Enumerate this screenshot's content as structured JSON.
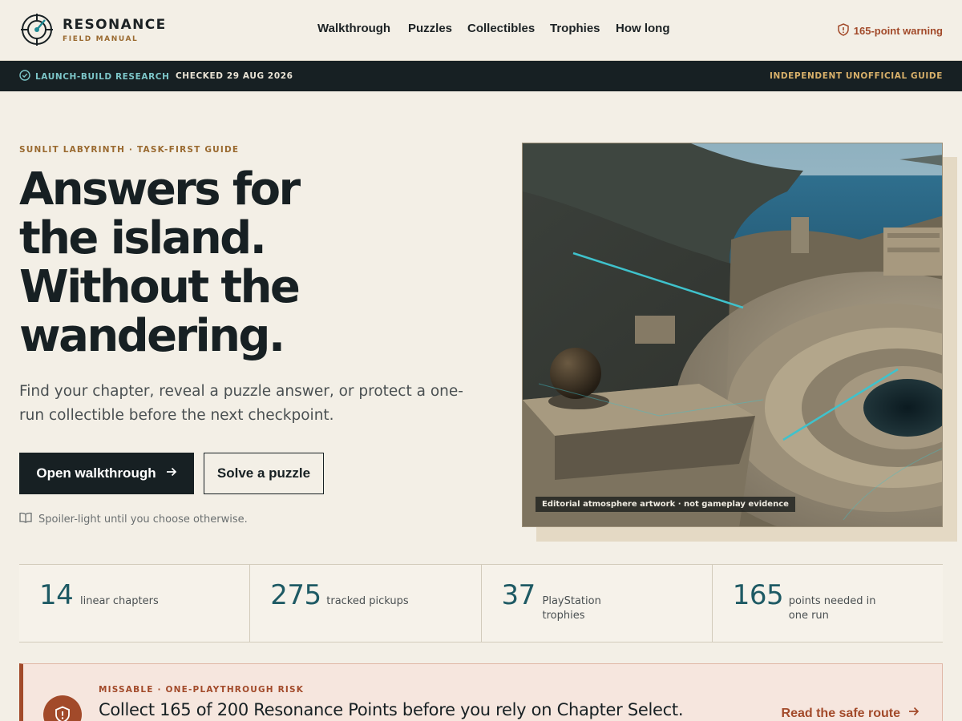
{
  "brand": {
    "name": "RESONANCE",
    "subtitle": "FIELD MANUAL",
    "logo_icon": "compass-target-icon"
  },
  "nav": {
    "items": [
      {
        "label": "Walkthrough"
      },
      {
        "label": "Puzzles"
      },
      {
        "label": "Collectibles"
      },
      {
        "label": "Trophies"
      },
      {
        "label": "How long"
      }
    ]
  },
  "header_warning": {
    "label": "165-point warning",
    "icon": "shield-alert-icon"
  },
  "status_bar": {
    "research": "LAUNCH-BUILD RESEARCH",
    "checked": "CHECKED 29 AUG 2026",
    "guide": "INDEPENDENT UNOFFICIAL GUIDE"
  },
  "hero": {
    "eyebrow": "SUNLIT LABYRINTH · TASK-FIRST GUIDE",
    "headline": [
      "Answers for",
      "the island.",
      "Without the",
      "wandering."
    ],
    "lede": "Find your chapter, reveal a puzzle answer, or protect a one-run collectible before the next checkpoint.",
    "primary_button": "Open walkthrough",
    "secondary_button": "Solve a puzzle",
    "note": "Spoiler-light until you choose otherwise.",
    "art_caption": "Editorial atmosphere artwork · not gameplay evidence"
  },
  "stats": [
    {
      "value": "14",
      "label": "linear chapters"
    },
    {
      "value": "275",
      "label": "tracked pickups"
    },
    {
      "value": "37",
      "label": "PlayStation trophies"
    },
    {
      "value": "165",
      "label": "points needed in one run"
    }
  ],
  "alert": {
    "eyebrow": "MISSABLE · ONE-PLAYTHROUGH RISK",
    "title": "Collect 165 of 200 Resonance Points before you rely on Chapter Select.",
    "link": "Read the safe route"
  },
  "colors": {
    "accent": "#a24a2a",
    "teal": "#1e5a64",
    "dark": "#172023",
    "gold": "#9a6a30"
  }
}
